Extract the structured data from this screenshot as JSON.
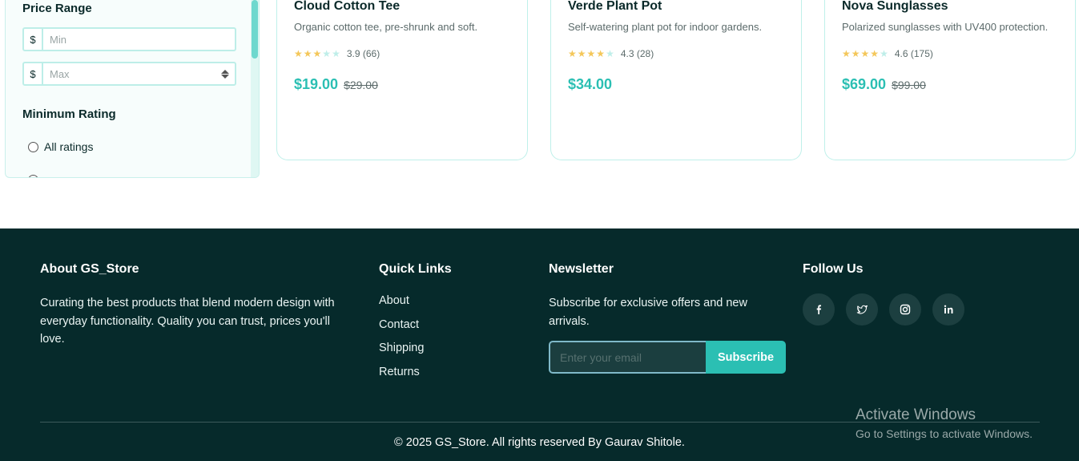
{
  "filters": {
    "price_range_title": "Price Range",
    "currency_symbol": "$",
    "min_placeholder": "Min",
    "max_placeholder": "Max",
    "min_rating_title": "Minimum Rating",
    "rating_options": [
      "All ratings"
    ]
  },
  "products": [
    {
      "name": "Cloud Cotton Tee",
      "description": "Organic cotton tee, pre-shrunk and soft.",
      "rating": 3.9,
      "rating_label": "3.9 (66)",
      "stars_filled": 3,
      "price": "$19.00",
      "original_price": "$29.00"
    },
    {
      "name": "Verde Plant Pot",
      "description": "Self-watering plant pot for indoor gardens.",
      "rating": 4.3,
      "rating_label": "4.3 (28)",
      "stars_filled": 4,
      "price": "$34.00",
      "original_price": ""
    },
    {
      "name": "Nova Sunglasses",
      "description": "Polarized sunglasses with UV400 protection.",
      "rating": 4.6,
      "rating_label": "4.6 (175)",
      "stars_filled": 4,
      "price": "$69.00",
      "original_price": "$99.00"
    }
  ],
  "footer": {
    "about_title": "About GS_Store",
    "about_text": "Curating the best products that blend modern design with everyday functionality. Quality you can trust, prices you'll love.",
    "quick_links_title": "Quick Links",
    "quick_links": [
      "About",
      "Contact",
      "Shipping",
      "Returns"
    ],
    "newsletter_title": "Newsletter",
    "newsletter_text": "Subscribe for exclusive offers and new arrivals.",
    "email_placeholder": "Enter your email",
    "subscribe_label": "Subscribe",
    "follow_title": "Follow Us",
    "socials": [
      {
        "icon": "facebook-icon",
        "glyph": "f"
      },
      {
        "icon": "twitter-icon",
        "glyph": "twitter"
      },
      {
        "icon": "instagram-icon",
        "glyph": "instagram"
      },
      {
        "icon": "linkedin-icon",
        "glyph": "in"
      }
    ],
    "copyright": "© 2025 GS_Store. All rights reserved By Gaurav Shitole."
  },
  "watermark": {
    "line1": "Activate Windows",
    "line2": "Go to Settings to activate Windows."
  },
  "colors": {
    "accent": "#2bbfb3",
    "footer_bg": "#062a2b",
    "star": "#f4c75a"
  }
}
